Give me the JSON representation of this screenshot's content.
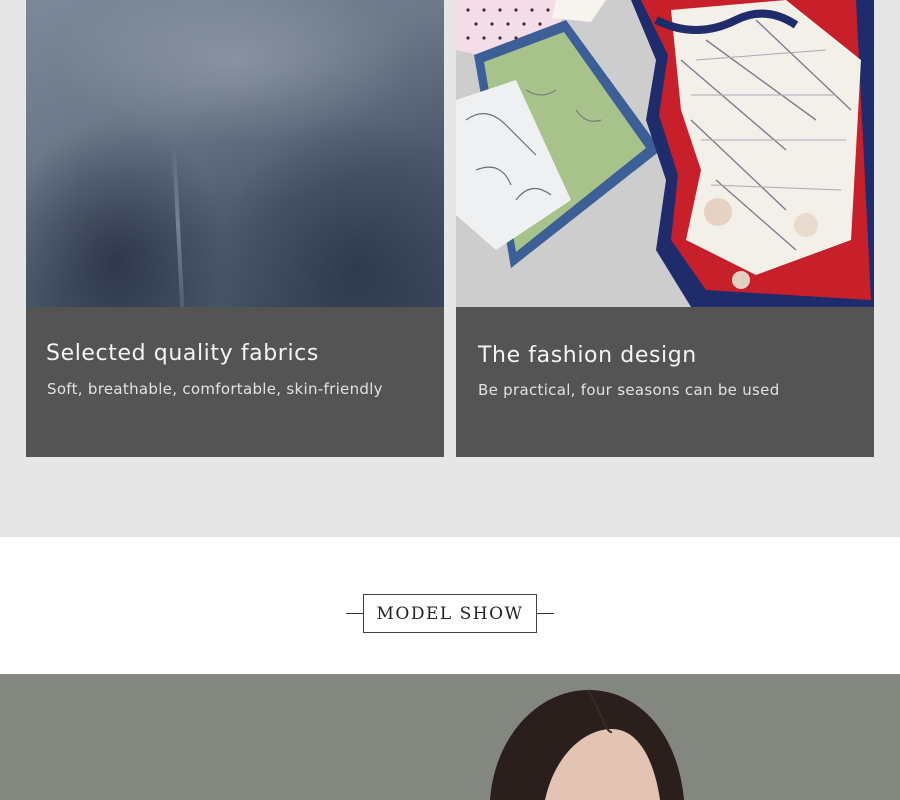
{
  "features": [
    {
      "title": "Selected quality fabrics",
      "subtitle": "Soft, breathable, comfortable, skin-friendly"
    },
    {
      "title": "The fashion design",
      "subtitle": "Be practical, four seasons can be used"
    }
  ],
  "section_heading": "MODEL SHOW",
  "colors": {
    "caption_background": "#545454",
    "band_background": "#e6e6e6",
    "scarf_red": "#c8202a",
    "scarf_navy": "#1f2c6b",
    "scarf_green": "#a9c48a",
    "scarf_blue": "#3e5f99"
  }
}
